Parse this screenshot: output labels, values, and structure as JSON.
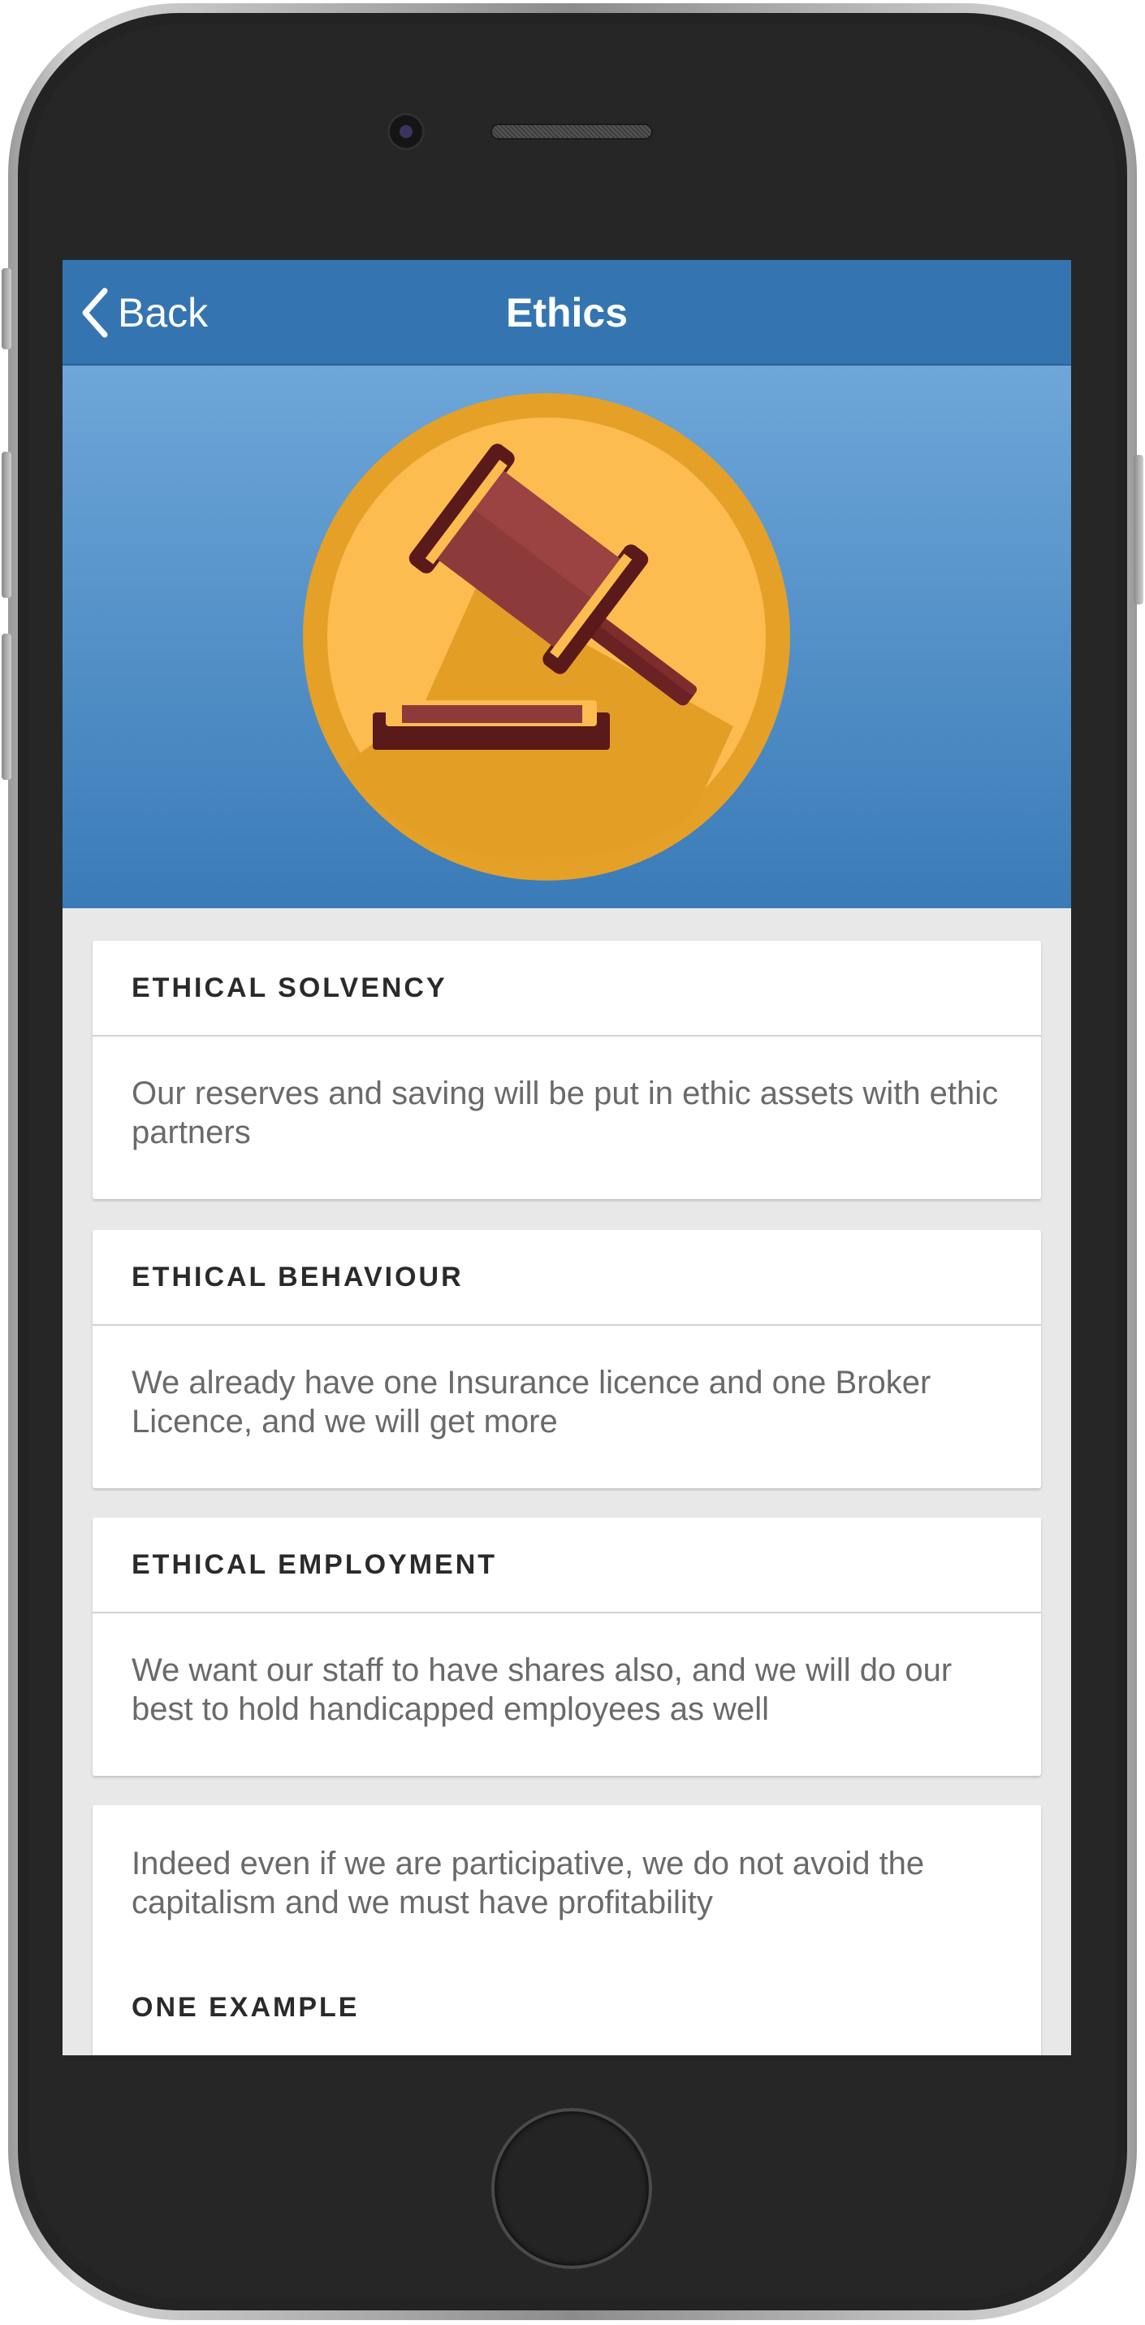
{
  "navbar": {
    "back_label": "Back",
    "title": "Ethics"
  },
  "hero": {
    "icon": "gavel-icon",
    "colors": {
      "background_top": "#6ea6d8",
      "background_bottom": "#3a7bb8",
      "circle_outer": "#e5a028",
      "circle_inner": "#fcbc4f",
      "gavel": "#8d3a3a"
    }
  },
  "cards": [
    {
      "title": "ETHICAL SOLVENCY",
      "body": "Our reserves and saving will be put in ethic assets with ethic partners"
    },
    {
      "title": "ETHICAL BEHAVIOUR",
      "body": "We already have one Insurance licence and one Broker Licence, and we will get more"
    },
    {
      "title": "ETHICAL EMPLOYMENT",
      "body": "We want our staff to have shares also, and we will do our best to hold handicapped employees as well"
    }
  ],
  "note_card": {
    "body": "Indeed even if we are participative, we do not avoid the capitalism and we must have profitability",
    "sub_title": "ONE EXAMPLE"
  },
  "colors": {
    "accent": "#3475b1",
    "page_background": "#e8e8e8"
  }
}
